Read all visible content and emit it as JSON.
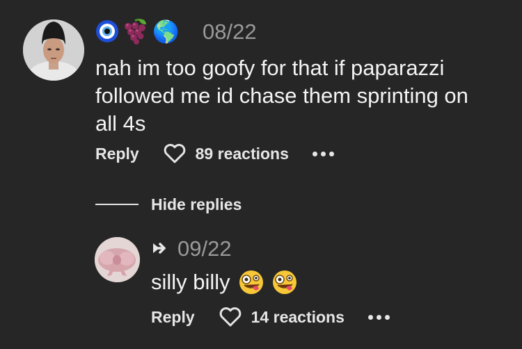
{
  "comment": {
    "badges": [
      "nazar-amulet",
      "grapes",
      "globe-americas"
    ],
    "badge_glyphs": {
      "globe": "🌎"
    },
    "date": "08/22",
    "text": "nah im too goofy for that if paparazzi followed me id chase them sprinting on all 4s",
    "actions": {
      "reply_label": "Reply",
      "reactions_label": "89 reactions"
    },
    "hide_replies_label": "Hide replies"
  },
  "reply": {
    "date": "09/22",
    "text": "silly billy",
    "emojis": [
      "zany-face",
      "zany-face"
    ],
    "actions": {
      "reply_label": "Reply",
      "reactions_label": "14 reactions"
    }
  },
  "colors": {
    "background": "#262626",
    "text_primary": "#f4f4f4",
    "text_muted": "#9a9a9a",
    "action_text": "#e6e6e6"
  }
}
